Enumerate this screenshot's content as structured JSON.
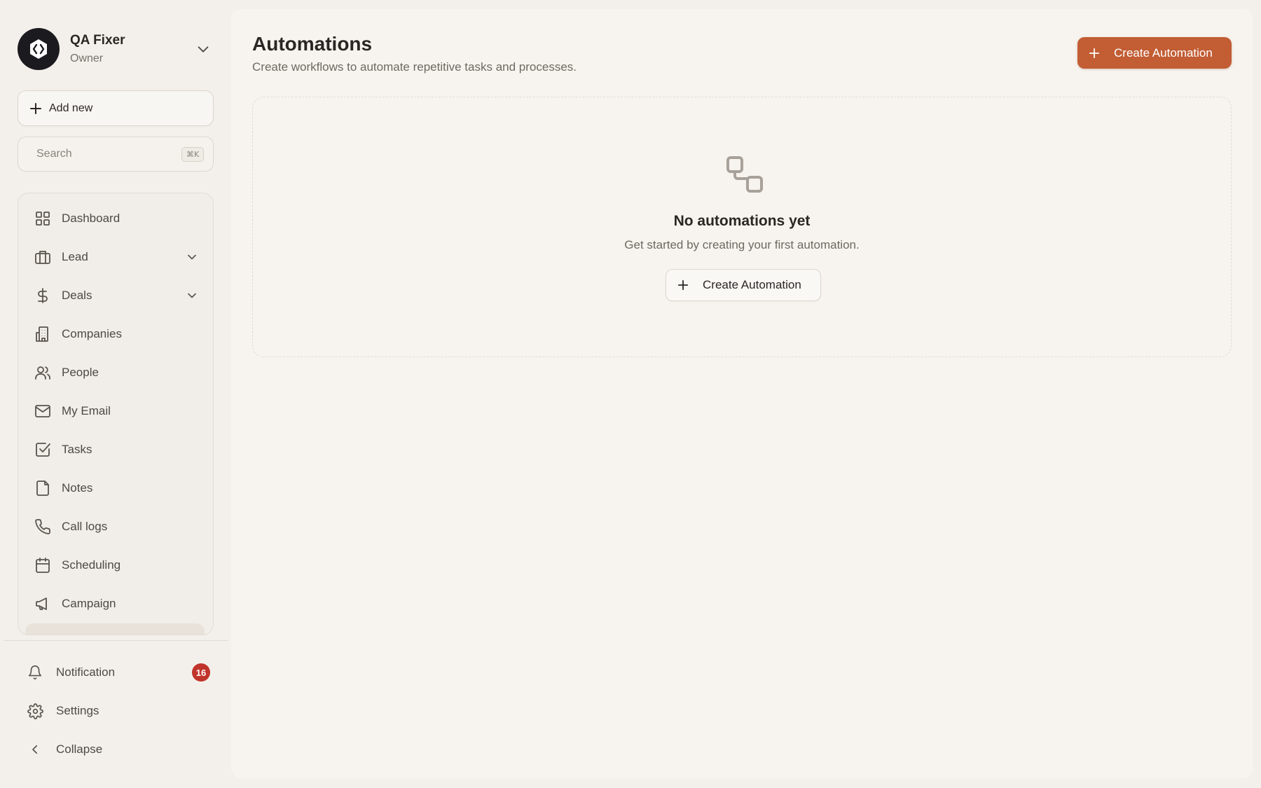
{
  "workspace": {
    "name": "QA Fixer",
    "role": "Owner"
  },
  "sidebar": {
    "add_new_label": "Add new",
    "search": {
      "placeholder": "Search",
      "shortcut": "⌘K"
    },
    "nav_items": [
      {
        "label": "Dashboard",
        "icon": "grid-icon"
      },
      {
        "label": "Lead",
        "icon": "briefcase-icon",
        "expandable": true
      },
      {
        "label": "Deals",
        "icon": "dollar-icon",
        "expandable": true
      },
      {
        "label": "Companies",
        "icon": "building-icon"
      },
      {
        "label": "People",
        "icon": "users-icon"
      },
      {
        "label": "My Email",
        "icon": "mail-icon"
      },
      {
        "label": "Tasks",
        "icon": "checkbox-icon"
      },
      {
        "label": "Notes",
        "icon": "note-icon"
      },
      {
        "label": "Call logs",
        "icon": "phone-icon"
      },
      {
        "label": "Scheduling",
        "icon": "calendar-icon"
      },
      {
        "label": "Campaign",
        "icon": "megaphone-icon"
      }
    ],
    "bottom": {
      "notification": {
        "label": "Notification",
        "count": "16"
      },
      "settings": {
        "label": "Settings"
      },
      "collapse": {
        "label": "Collapse"
      }
    }
  },
  "main": {
    "title": "Automations",
    "subtitle": "Create workflows to automate repetitive tasks and processes.",
    "create_button": "Create Automation",
    "empty": {
      "title": "No automations yet",
      "subtitle": "Get started by creating your first automation.",
      "button": "Create Automation"
    }
  },
  "colors": {
    "accent": "#c25d34",
    "badge": "#c0342b",
    "background": "#f3f0eb"
  }
}
